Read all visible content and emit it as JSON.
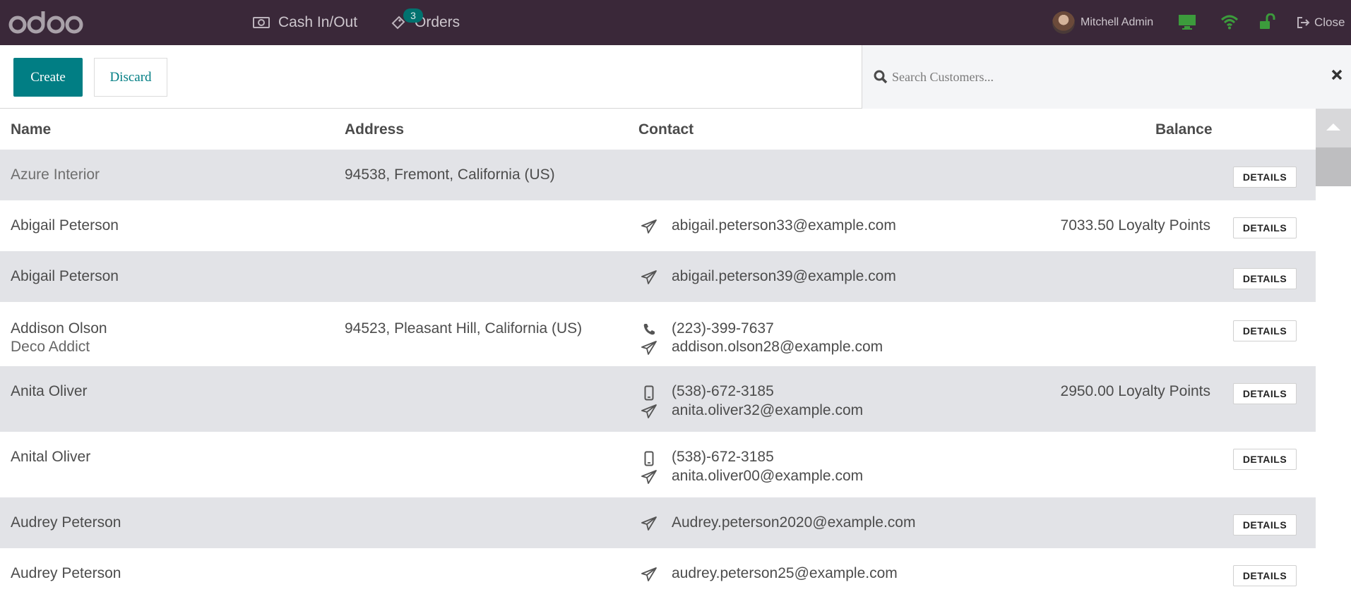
{
  "topbar": {
    "logo_text": "odoo",
    "cash_label": "Cash In/Out",
    "orders_label": "Orders",
    "orders_badge": "3",
    "user_name": "Mitchell Admin",
    "close_label": "Close"
  },
  "controls": {
    "create_label": "Create",
    "discard_label": "Discard",
    "search_placeholder": "Search Customers..."
  },
  "table": {
    "headers": {
      "name": "Name",
      "address": "Address",
      "contact": "Contact",
      "balance": "Balance"
    },
    "details_label": "DETAILS",
    "rows": [
      {
        "name": "Azure Interior",
        "company": "",
        "address": "94538, Fremont, California (US)",
        "phone": "",
        "phone_type": "",
        "email": "",
        "balance": ""
      },
      {
        "name": "Abigail Peterson",
        "company": "",
        "address": "",
        "phone": "",
        "phone_type": "",
        "email": "abigail.peterson33@example.com",
        "balance": "7033.50 Loyalty Points"
      },
      {
        "name": "Abigail Peterson",
        "company": "",
        "address": "",
        "phone": "",
        "phone_type": "",
        "email": "abigail.peterson39@example.com",
        "balance": ""
      },
      {
        "name": "Addison Olson",
        "company": "Deco Addict",
        "address": "94523, Pleasant Hill, California (US)",
        "phone": "(223)-399-7637",
        "phone_type": "phone",
        "email": "addison.olson28@example.com",
        "balance": ""
      },
      {
        "name": "Anita Oliver",
        "company": "",
        "address": "",
        "phone": "(538)-672-3185",
        "phone_type": "mobile",
        "email": "anita.oliver32@example.com",
        "balance": "2950.00 Loyalty Points"
      },
      {
        "name": "Anital Oliver",
        "company": "",
        "address": "",
        "phone": "(538)-672-3185",
        "phone_type": "mobile",
        "email": "anita.oliver00@example.com",
        "balance": ""
      },
      {
        "name": "Audrey Peterson",
        "company": "",
        "address": "",
        "phone": "",
        "phone_type": "",
        "email": "Audrey.peterson2020@example.com",
        "balance": ""
      },
      {
        "name": "Audrey Peterson",
        "company": "",
        "address": "",
        "phone": "",
        "phone_type": "",
        "email": "audrey.peterson25@example.com",
        "balance": ""
      }
    ]
  },
  "colors": {
    "topbar_bg": "#3a2839",
    "accent": "#017e84",
    "row_alt_bg": "#e2e3e7",
    "status_green": "#3c9b3c"
  },
  "icons": {
    "cash": "money-icon",
    "orders": "ticket-icon",
    "screen": "desktop-icon",
    "network": "wifi-icon",
    "lock": "unlock-icon",
    "close": "sign-out-icon",
    "search": "search-icon",
    "clear": "close-icon",
    "email": "paper-plane-icon",
    "phone": "phone-icon",
    "mobile": "mobile-icon",
    "scroll_up": "caret-up-icon"
  }
}
